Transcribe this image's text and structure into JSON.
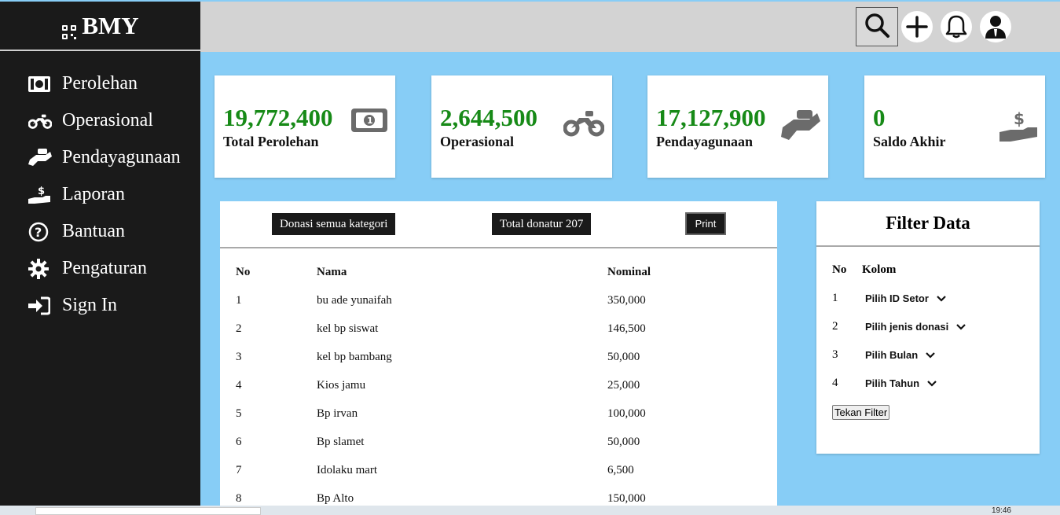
{
  "brand": {
    "title": "BMY"
  },
  "sidebar": {
    "items": [
      {
        "label": "Perolehan",
        "icon": "money-bill-icon"
      },
      {
        "label": "Operasional",
        "icon": "motorcycle-icon"
      },
      {
        "label": "Pendayagunaan",
        "icon": "hand-holding-icon"
      },
      {
        "label": "Laporan",
        "icon": "hand-dollar-icon"
      },
      {
        "label": "Bantuan",
        "icon": "question-circle-icon"
      },
      {
        "label": "Pengaturan",
        "icon": "gear-icon"
      },
      {
        "label": "Sign In",
        "icon": "sign-in-icon"
      }
    ]
  },
  "topbar": {
    "icons": [
      "search-icon",
      "plus-icon",
      "bell-icon",
      "user-icon"
    ]
  },
  "cards": [
    {
      "value": "19,772,400",
      "label": "Total Perolehan",
      "icon": "money-bill-icon"
    },
    {
      "value": "2,644,500",
      "label": "Operasional",
      "icon": "motorcycle-icon"
    },
    {
      "value": "17,127,900",
      "label": "Pendayagunaan",
      "icon": "hand-holding-icon"
    },
    {
      "value": "0",
      "label": "Saldo Akhir",
      "icon": "hand-dollar-icon"
    }
  ],
  "table_panel": {
    "category_tag": "Donasi semua kategori",
    "donor_tag": "Total donatur 207",
    "print_label": "Print",
    "columns": [
      "No",
      "Nama",
      "Nominal"
    ],
    "rows": [
      [
        "1",
        "bu ade yunaifah",
        "350,000"
      ],
      [
        "2",
        "kel bp siswat",
        "146,500"
      ],
      [
        "3",
        "kel bp bambang",
        "50,000"
      ],
      [
        "4",
        "Kios jamu",
        "25,000"
      ],
      [
        "5",
        "Bp irvan",
        "100,000"
      ],
      [
        "6",
        "Bp slamet",
        "50,000"
      ],
      [
        "7",
        "Idolaku mart",
        "6,500"
      ],
      [
        "8",
        "Bp Alto",
        "150,000"
      ]
    ]
  },
  "filter": {
    "title": "Filter Data",
    "col_no": "No",
    "col_kolom": "Kolom",
    "rows": [
      {
        "no": "1",
        "select": "Pilih ID Setor"
      },
      {
        "no": "2",
        "select": "Pilih jenis donasi"
      },
      {
        "no": "3",
        "select": "Pilih Bulan"
      },
      {
        "no": "4",
        "select": "Pilih Tahun"
      }
    ],
    "button": "Tekan Filter"
  },
  "taskbar": {
    "clock": "19:46"
  },
  "colors": {
    "sidebar": "#1a1a1a",
    "background": "#87cdf6",
    "value_green": "#178a17",
    "icon_gray": "#6b6b6b"
  }
}
